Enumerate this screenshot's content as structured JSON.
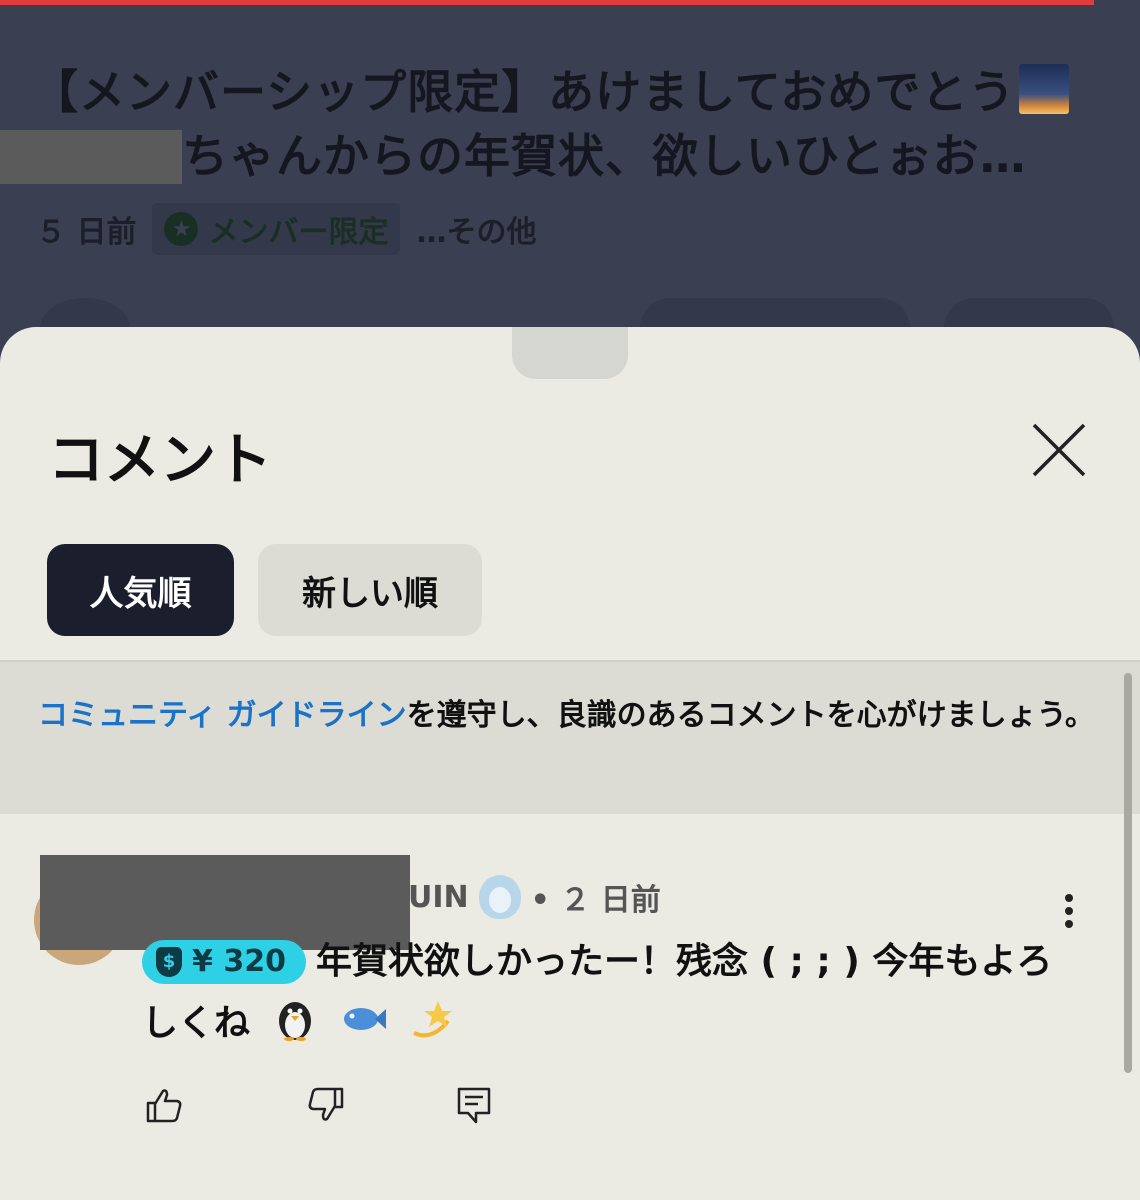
{
  "video": {
    "progress_fraction": 0.96,
    "title": "【メンバーシップ限定】あけましておめでとう",
    "title_line2": "ちゃんからの年賀状、欲しいひとぉお…",
    "title_emoji": "sunrise-over-mountains-emoji",
    "age": "５ 日前",
    "member_badge": "メンバー限定",
    "more": "…その他"
  },
  "sheet": {
    "title": "コメント",
    "close_icon": "close-icon",
    "sort_chips": [
      {
        "label": "人気順",
        "active": true
      },
      {
        "label": "新しい順",
        "active": false
      }
    ],
    "guideline": {
      "link": "コミュニティ ガイドライン",
      "text": "を遵守し、良識のあるコメントを心がけましょう。"
    }
  },
  "comment": {
    "author_visible": "UIN",
    "badge_icon": "penguin-badge-icon",
    "time": "• ２ 日前",
    "super_thanks": "¥ 320",
    "text": "年賀状欲しかったー！残念 ( ; ; ) 今年もよろしくね",
    "emojis": [
      "penguin",
      "fish",
      "dizzy"
    ],
    "actions": [
      "like-icon",
      "dislike-icon",
      "reply-icon"
    ]
  },
  "colors": {
    "accent_link": "#1a73c9",
    "progress_red": "#e23b3b",
    "super_chip": "#2ed0e6",
    "active_chip": "#1b1e2d"
  }
}
